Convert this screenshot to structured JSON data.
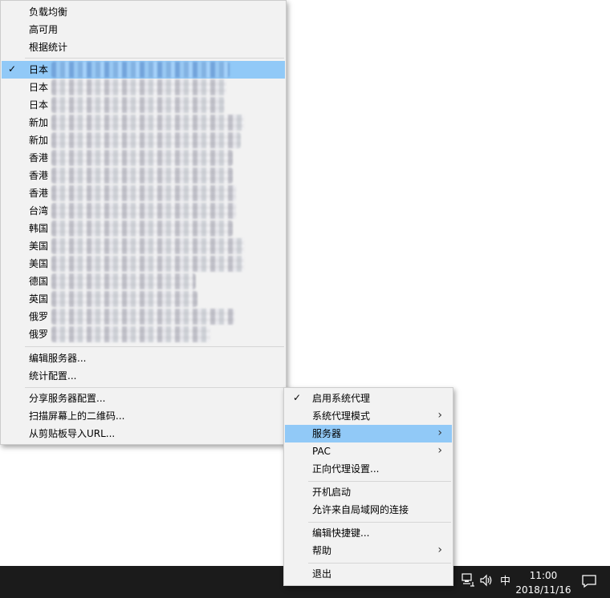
{
  "submenu": {
    "top_items": [
      "负载均衡",
      "高可用",
      "根据统计"
    ],
    "servers": [
      {
        "prefix": "日本",
        "checked": true,
        "highlighted": true
      },
      {
        "prefix": "日本",
        "checked": false,
        "highlighted": false
      },
      {
        "prefix": "日本",
        "checked": false,
        "highlighted": false
      },
      {
        "prefix": "新加",
        "checked": false,
        "highlighted": false
      },
      {
        "prefix": "新加",
        "checked": false,
        "highlighted": false
      },
      {
        "prefix": "香港",
        "checked": false,
        "highlighted": false
      },
      {
        "prefix": "香港",
        "checked": false,
        "highlighted": false
      },
      {
        "prefix": "香港",
        "checked": false,
        "highlighted": false
      },
      {
        "prefix": "台湾",
        "checked": false,
        "highlighted": false
      },
      {
        "prefix": "韩国",
        "checked": false,
        "highlighted": false
      },
      {
        "prefix": "美国",
        "checked": false,
        "highlighted": false
      },
      {
        "prefix": "美国",
        "checked": false,
        "highlighted": false
      },
      {
        "prefix": "德国",
        "checked": false,
        "highlighted": false
      },
      {
        "prefix": "英国",
        "checked": false,
        "highlighted": false
      },
      {
        "prefix": "俄罗",
        "checked": false,
        "highlighted": false
      },
      {
        "prefix": "俄罗",
        "checked": false,
        "highlighted": false
      }
    ],
    "edit_servers": "编辑服务器...",
    "stats_config": "统计配置...",
    "share_config": "分享服务器配置...",
    "scan_qr": "扫描屏幕上的二维码...",
    "import_url": "从剪贴板导入URL..."
  },
  "mainmenu": {
    "enable_proxy": "启用系统代理",
    "proxy_mode": "系统代理模式",
    "servers": "服务器",
    "pac": "PAC",
    "forward_proxy": "正向代理设置...",
    "autostart": "开机启动",
    "allow_lan": "允许来自局域网的连接",
    "edit_hotkeys": "编辑快捷键...",
    "help": "帮助",
    "quit": "退出"
  },
  "taskbar": {
    "ime": "中",
    "time": "11:00",
    "date": "2018/11/16"
  },
  "icons": {
    "check": "check-icon",
    "submenu_arrow": "chevron-right-icon",
    "network": "network-icon",
    "volume": "volume-icon",
    "notification": "action-center-icon"
  },
  "colors": {
    "menu_bg": "#f2f2f2",
    "highlight": "#91c9f7",
    "taskbar": "#1b1b1b"
  }
}
